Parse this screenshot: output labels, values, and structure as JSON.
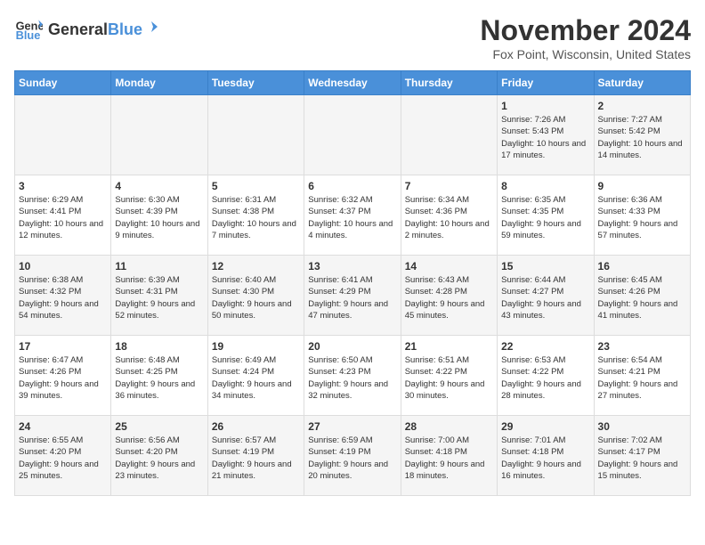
{
  "logo": {
    "general": "General",
    "blue": "Blue"
  },
  "title": "November 2024",
  "location": "Fox Point, Wisconsin, United States",
  "days_header": [
    "Sunday",
    "Monday",
    "Tuesday",
    "Wednesday",
    "Thursday",
    "Friday",
    "Saturday"
  ],
  "weeks": [
    [
      {
        "day": "",
        "info": ""
      },
      {
        "day": "",
        "info": ""
      },
      {
        "day": "",
        "info": ""
      },
      {
        "day": "",
        "info": ""
      },
      {
        "day": "",
        "info": ""
      },
      {
        "day": "1",
        "info": "Sunrise: 7:26 AM\nSunset: 5:43 PM\nDaylight: 10 hours and 17 minutes."
      },
      {
        "day": "2",
        "info": "Sunrise: 7:27 AM\nSunset: 5:42 PM\nDaylight: 10 hours and 14 minutes."
      }
    ],
    [
      {
        "day": "3",
        "info": "Sunrise: 6:29 AM\nSunset: 4:41 PM\nDaylight: 10 hours and 12 minutes."
      },
      {
        "day": "4",
        "info": "Sunrise: 6:30 AM\nSunset: 4:39 PM\nDaylight: 10 hours and 9 minutes."
      },
      {
        "day": "5",
        "info": "Sunrise: 6:31 AM\nSunset: 4:38 PM\nDaylight: 10 hours and 7 minutes."
      },
      {
        "day": "6",
        "info": "Sunrise: 6:32 AM\nSunset: 4:37 PM\nDaylight: 10 hours and 4 minutes."
      },
      {
        "day": "7",
        "info": "Sunrise: 6:34 AM\nSunset: 4:36 PM\nDaylight: 10 hours and 2 minutes."
      },
      {
        "day": "8",
        "info": "Sunrise: 6:35 AM\nSunset: 4:35 PM\nDaylight: 9 hours and 59 minutes."
      },
      {
        "day": "9",
        "info": "Sunrise: 6:36 AM\nSunset: 4:33 PM\nDaylight: 9 hours and 57 minutes."
      }
    ],
    [
      {
        "day": "10",
        "info": "Sunrise: 6:38 AM\nSunset: 4:32 PM\nDaylight: 9 hours and 54 minutes."
      },
      {
        "day": "11",
        "info": "Sunrise: 6:39 AM\nSunset: 4:31 PM\nDaylight: 9 hours and 52 minutes."
      },
      {
        "day": "12",
        "info": "Sunrise: 6:40 AM\nSunset: 4:30 PM\nDaylight: 9 hours and 50 minutes."
      },
      {
        "day": "13",
        "info": "Sunrise: 6:41 AM\nSunset: 4:29 PM\nDaylight: 9 hours and 47 minutes."
      },
      {
        "day": "14",
        "info": "Sunrise: 6:43 AM\nSunset: 4:28 PM\nDaylight: 9 hours and 45 minutes."
      },
      {
        "day": "15",
        "info": "Sunrise: 6:44 AM\nSunset: 4:27 PM\nDaylight: 9 hours and 43 minutes."
      },
      {
        "day": "16",
        "info": "Sunrise: 6:45 AM\nSunset: 4:26 PM\nDaylight: 9 hours and 41 minutes."
      }
    ],
    [
      {
        "day": "17",
        "info": "Sunrise: 6:47 AM\nSunset: 4:26 PM\nDaylight: 9 hours and 39 minutes."
      },
      {
        "day": "18",
        "info": "Sunrise: 6:48 AM\nSunset: 4:25 PM\nDaylight: 9 hours and 36 minutes."
      },
      {
        "day": "19",
        "info": "Sunrise: 6:49 AM\nSunset: 4:24 PM\nDaylight: 9 hours and 34 minutes."
      },
      {
        "day": "20",
        "info": "Sunrise: 6:50 AM\nSunset: 4:23 PM\nDaylight: 9 hours and 32 minutes."
      },
      {
        "day": "21",
        "info": "Sunrise: 6:51 AM\nSunset: 4:22 PM\nDaylight: 9 hours and 30 minutes."
      },
      {
        "day": "22",
        "info": "Sunrise: 6:53 AM\nSunset: 4:22 PM\nDaylight: 9 hours and 28 minutes."
      },
      {
        "day": "23",
        "info": "Sunrise: 6:54 AM\nSunset: 4:21 PM\nDaylight: 9 hours and 27 minutes."
      }
    ],
    [
      {
        "day": "24",
        "info": "Sunrise: 6:55 AM\nSunset: 4:20 PM\nDaylight: 9 hours and 25 minutes."
      },
      {
        "day": "25",
        "info": "Sunrise: 6:56 AM\nSunset: 4:20 PM\nDaylight: 9 hours and 23 minutes."
      },
      {
        "day": "26",
        "info": "Sunrise: 6:57 AM\nSunset: 4:19 PM\nDaylight: 9 hours and 21 minutes."
      },
      {
        "day": "27",
        "info": "Sunrise: 6:59 AM\nSunset: 4:19 PM\nDaylight: 9 hours and 20 minutes."
      },
      {
        "day": "28",
        "info": "Sunrise: 7:00 AM\nSunset: 4:18 PM\nDaylight: 9 hours and 18 minutes."
      },
      {
        "day": "29",
        "info": "Sunrise: 7:01 AM\nSunset: 4:18 PM\nDaylight: 9 hours and 16 minutes."
      },
      {
        "day": "30",
        "info": "Sunrise: 7:02 AM\nSunset: 4:17 PM\nDaylight: 9 hours and 15 minutes."
      }
    ]
  ]
}
